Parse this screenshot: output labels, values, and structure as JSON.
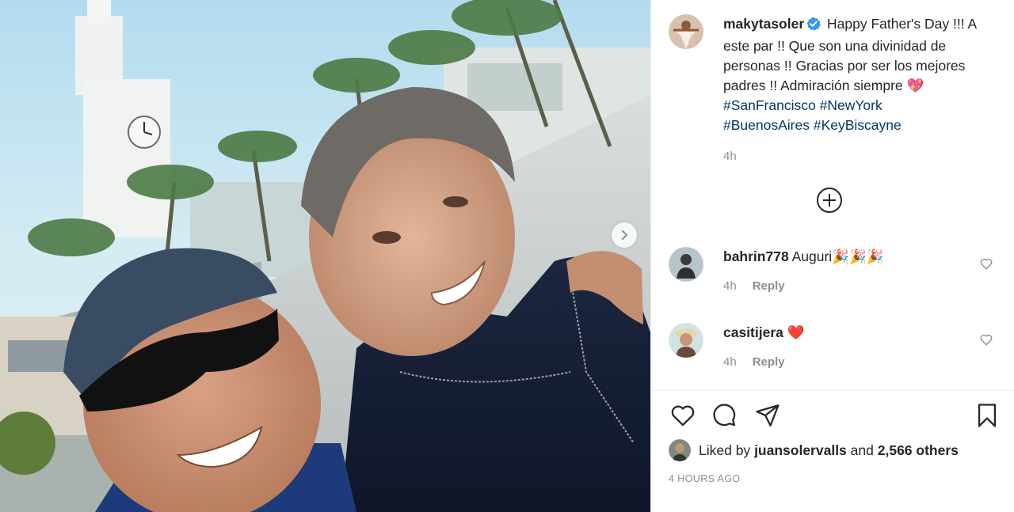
{
  "post": {
    "photo": {
      "alt_icon": "photo-of-two-men-smiling",
      "next_icon": "chevron-right-icon"
    },
    "author": {
      "username": "makytasoler",
      "verified": true
    },
    "caption": {
      "text": "Happy Father's Day !!! A este par !! Que son una divinidad de personas !! Gracias por ser los mejores padres !! Admiración siempre",
      "emoji": "💖",
      "hashtags": [
        "#SanFrancisco",
        "#NewYork",
        "#BuenosAires",
        "#KeyBiscayne"
      ],
      "time": "4h"
    },
    "load_more_icon": "plus-circle-icon",
    "comments": [
      {
        "username": "bahrin778",
        "text": "Auguri",
        "emoji": "🎉🎉🎉",
        "time": "4h",
        "reply_label": "Reply"
      },
      {
        "username": "casitijera",
        "text": "",
        "emoji": "❤️",
        "time": "4h",
        "reply_label": "Reply"
      }
    ],
    "actions": [
      "heart-icon",
      "comment-icon",
      "share-icon",
      "bookmark-icon"
    ],
    "likes": {
      "prefix": "Liked by",
      "user": "juansolervalls",
      "connector": "and",
      "count": "2,566 others"
    },
    "posted_at": "4 HOURS AGO"
  },
  "colors": {
    "text": "#262626",
    "secondary": "#8e8e8e",
    "hashtag": "#00376b",
    "verified": "#3897f0",
    "heart_red": "#ed4956"
  }
}
